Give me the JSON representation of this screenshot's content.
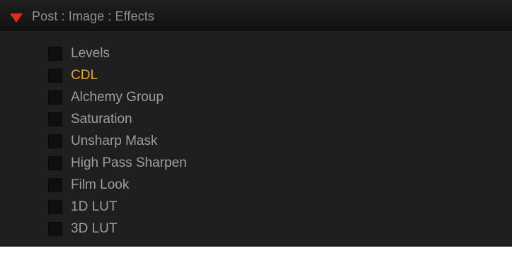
{
  "panel": {
    "title": "Post : Image : Effects",
    "expanded": true,
    "expander_color": "#e8281a"
  },
  "effects": [
    {
      "label": "Levels",
      "checked": false,
      "highlighted": false
    },
    {
      "label": "CDL",
      "checked": false,
      "highlighted": true
    },
    {
      "label": "Alchemy Group",
      "checked": false,
      "highlighted": false
    },
    {
      "label": "Saturation",
      "checked": false,
      "highlighted": false
    },
    {
      "label": "Unsharp Mask",
      "checked": false,
      "highlighted": false
    },
    {
      "label": "High Pass Sharpen",
      "checked": false,
      "highlighted": false
    },
    {
      "label": "Film Look",
      "checked": false,
      "highlighted": false
    },
    {
      "label": "1D LUT",
      "checked": false,
      "highlighted": false
    },
    {
      "label": "3D LUT",
      "checked": false,
      "highlighted": false
    }
  ],
  "colors": {
    "background": "#1f1f1f",
    "text": "#9e9e9e",
    "highlight": "#e5a833"
  }
}
